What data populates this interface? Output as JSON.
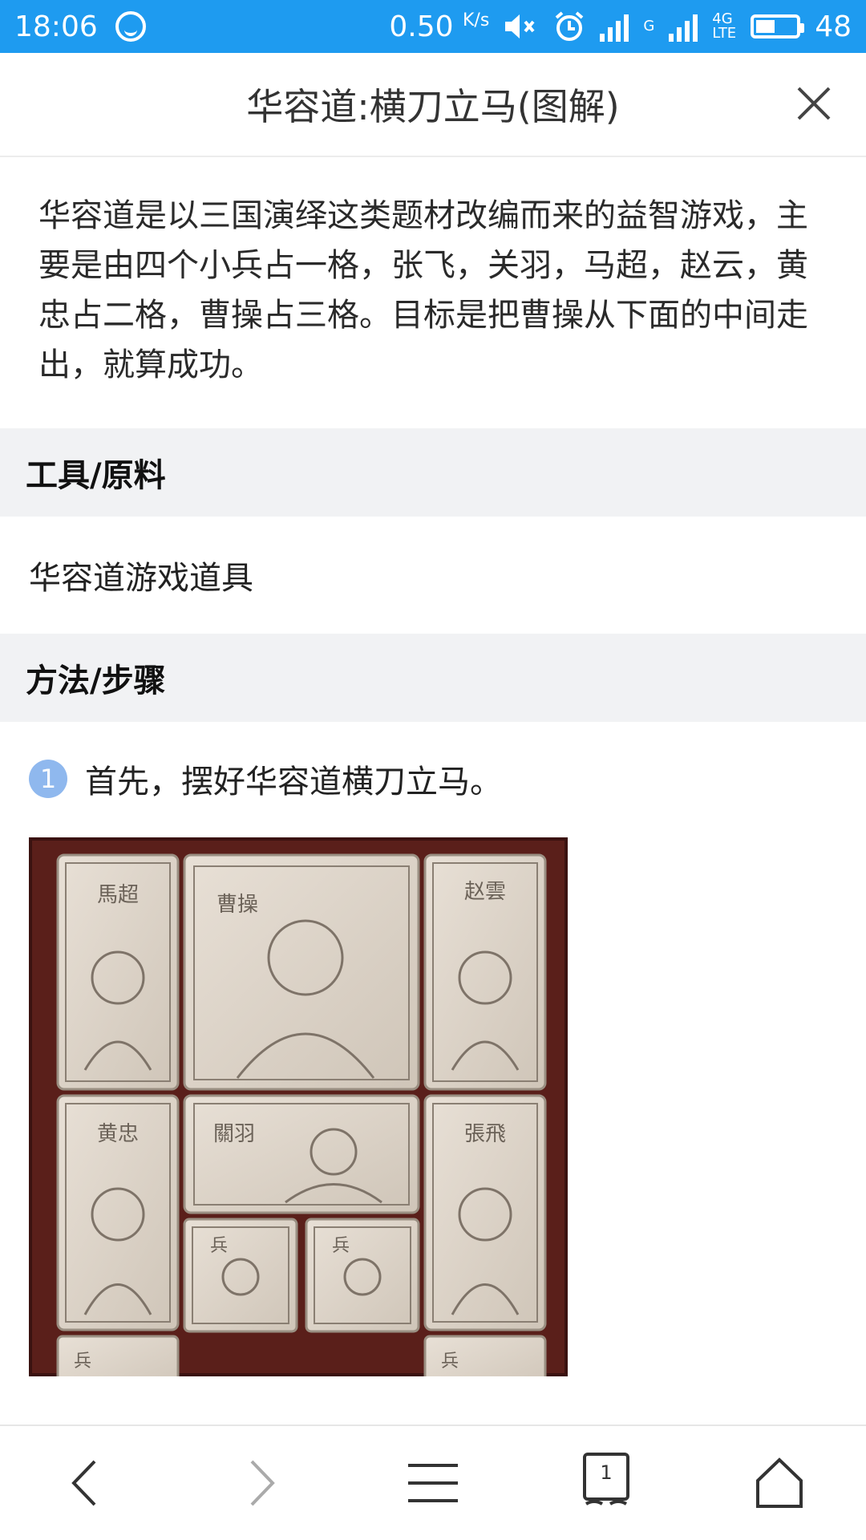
{
  "status_bar": {
    "time": "18:06",
    "net_speed": "0.50",
    "net_unit": "K/s",
    "network_g": "G",
    "network_4g": "4G",
    "network_lte": "LTE",
    "battery_level": "48"
  },
  "header": {
    "title": "华容道:横刀立马(图解)"
  },
  "intro": {
    "text": "华容道是以三国演绎这类题材改编而来的益智游戏，主要是由四个小兵占一格，张飞，关羽，马超，赵云，黄忠占二格，曹操占三格。目标是把曹操从下面的中间走出，就算成功。"
  },
  "tools": {
    "heading": "工具/原料",
    "text": "华容道游戏道具"
  },
  "method": {
    "heading": "方法/步骤",
    "steps": [
      {
        "number": "1",
        "text": "首先，摆好华容道横刀立马。"
      }
    ]
  },
  "puzzle_image": {
    "labels": {
      "machao": "馬超",
      "caocao": "曹操",
      "zhaoyun": "赵雲",
      "huangzhong": "黄忠",
      "guanyu": "關羽",
      "zhangfei": "張飛",
      "soldier": "兵"
    }
  },
  "bottom_nav": {
    "tab_count": "1"
  }
}
